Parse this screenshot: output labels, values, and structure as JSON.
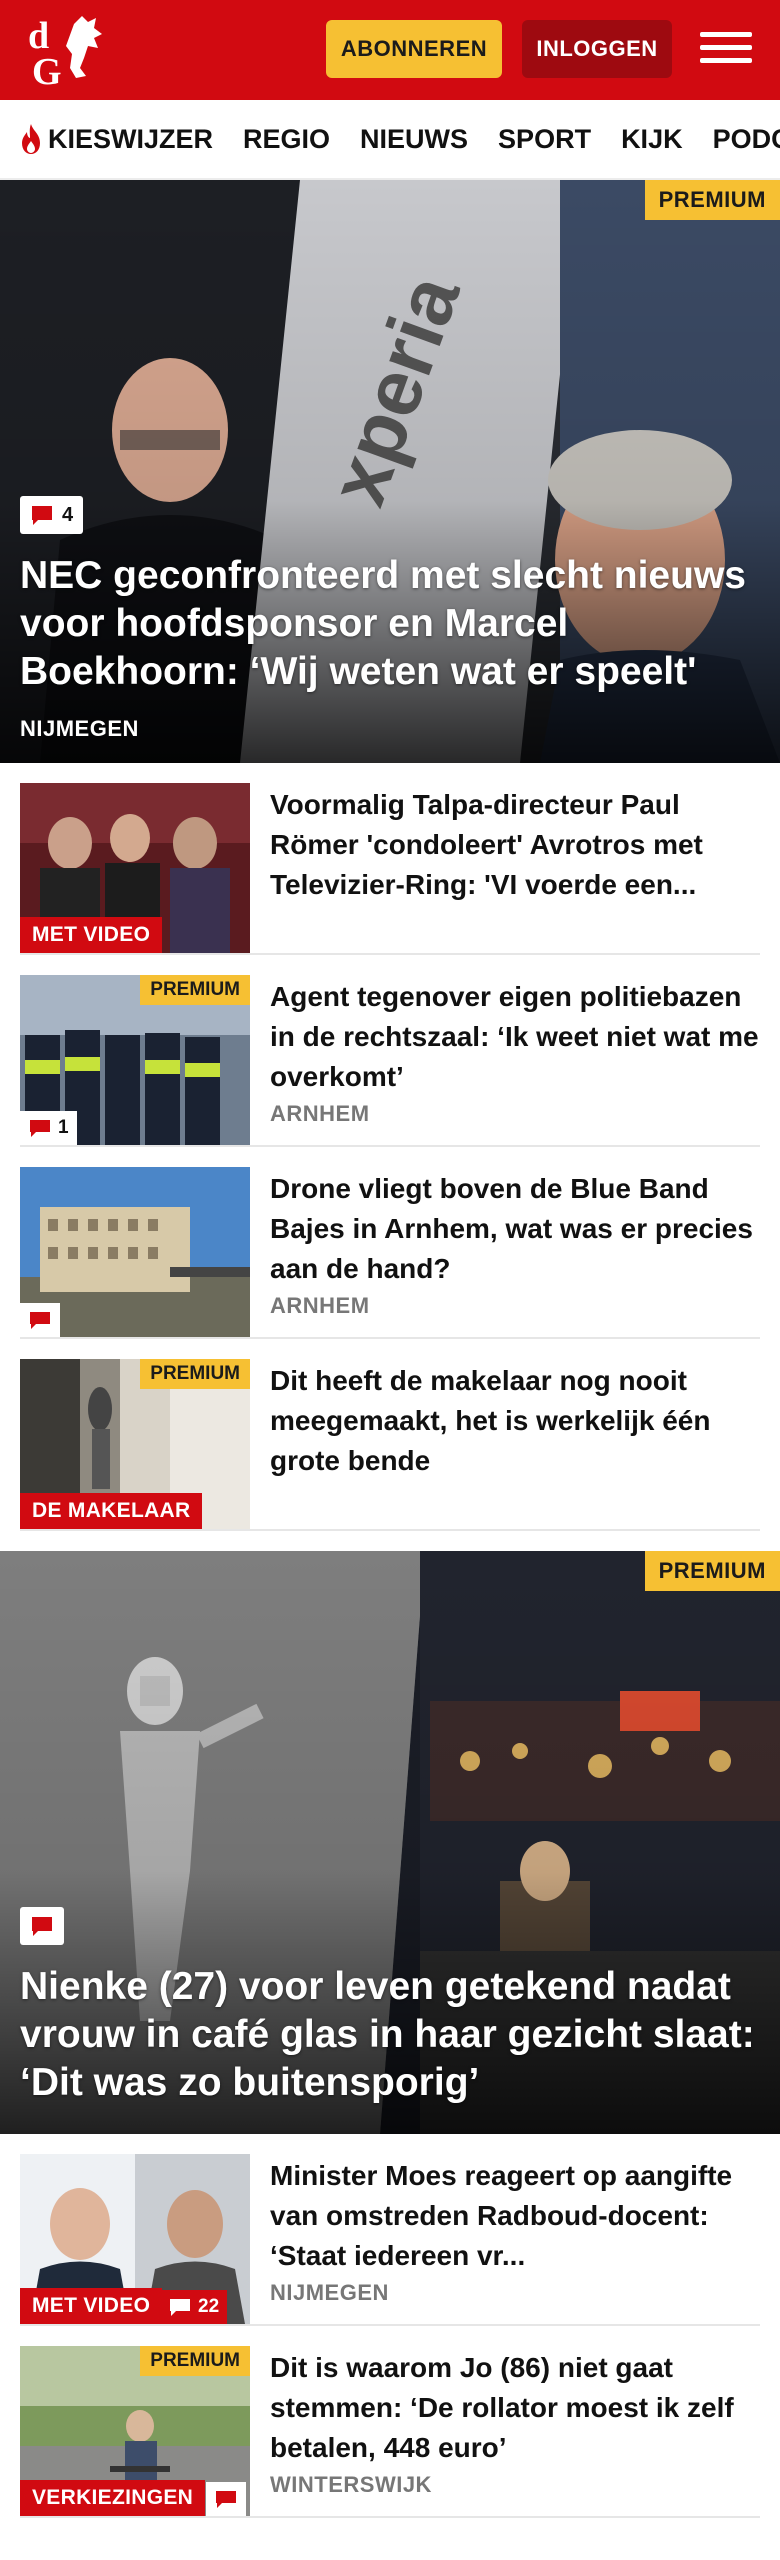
{
  "header": {
    "logo_text": "dG",
    "subscribe_label": "ABONNEREN",
    "login_label": "INLOGGEN"
  },
  "nav": {
    "items": [
      "KIESWIJZER",
      "REGIO",
      "NIEUWS",
      "SPORT",
      "KIJK",
      "PODCAS"
    ]
  },
  "hero1": {
    "premium": "PREMIUM",
    "comments": "4",
    "title": "NEC geconfronteerd met slecht nieuws voor hoofdsponsor en Marcel Boekhoorn: ‘Wij weten wat er speelt'",
    "region": "NIJMEGEN"
  },
  "articles": [
    {
      "title": "Voormalig Talpa-directeur Paul Römer 'condoleert' Avrotros met Televizier-Ring: 'VI voerde een...",
      "label": "MET VIDEO",
      "region": ""
    },
    {
      "title": "Agent tegenover eigen politieba­zen in de rechtszaal: ‘Ik weet niet wat me overkomt’",
      "premium": "PREMIUM",
      "comments": "1",
      "region": "ARNHEM"
    },
    {
      "title": "Drone vliegt boven de Blue Band Bajes in Arnhem, wat was er precies aan de hand?",
      "region": "ARNHEM"
    },
    {
      "title": "Dit heeft de makelaar nog nooit meegemaakt, het is werkelijk één grote bende",
      "premium": "PREMIUM",
      "label": "DE MAKELAAR",
      "region": ""
    }
  ],
  "hero2": {
    "premium": "PREMIUM",
    "title": "Nienke (27) voor leven getekend nadat vrouw in café glas in haar gezicht slaat: ‘Dit was zo buitensporig’"
  },
  "articles2": [
    {
      "title": "Minister Moes reageert op aangifte van omstreden Rad­boud-docent: ‘Staat iedereen vr...",
      "label": "MET VIDEO",
      "comments": "22",
      "region": "NIJMEGEN"
    },
    {
      "title": "Dit is waarom Jo (86) niet gaat stemmen: ‘De rollator moest ik zelf betalen, 448 euro’",
      "premium": "PREMIUM",
      "label": "VERKIEZINGEN",
      "region": "WINTERSWIJK"
    }
  ],
  "colors": {
    "brand_red": "#d10a11",
    "dark_red": "#9e0a10",
    "premium_yellow": "#f6c033"
  }
}
